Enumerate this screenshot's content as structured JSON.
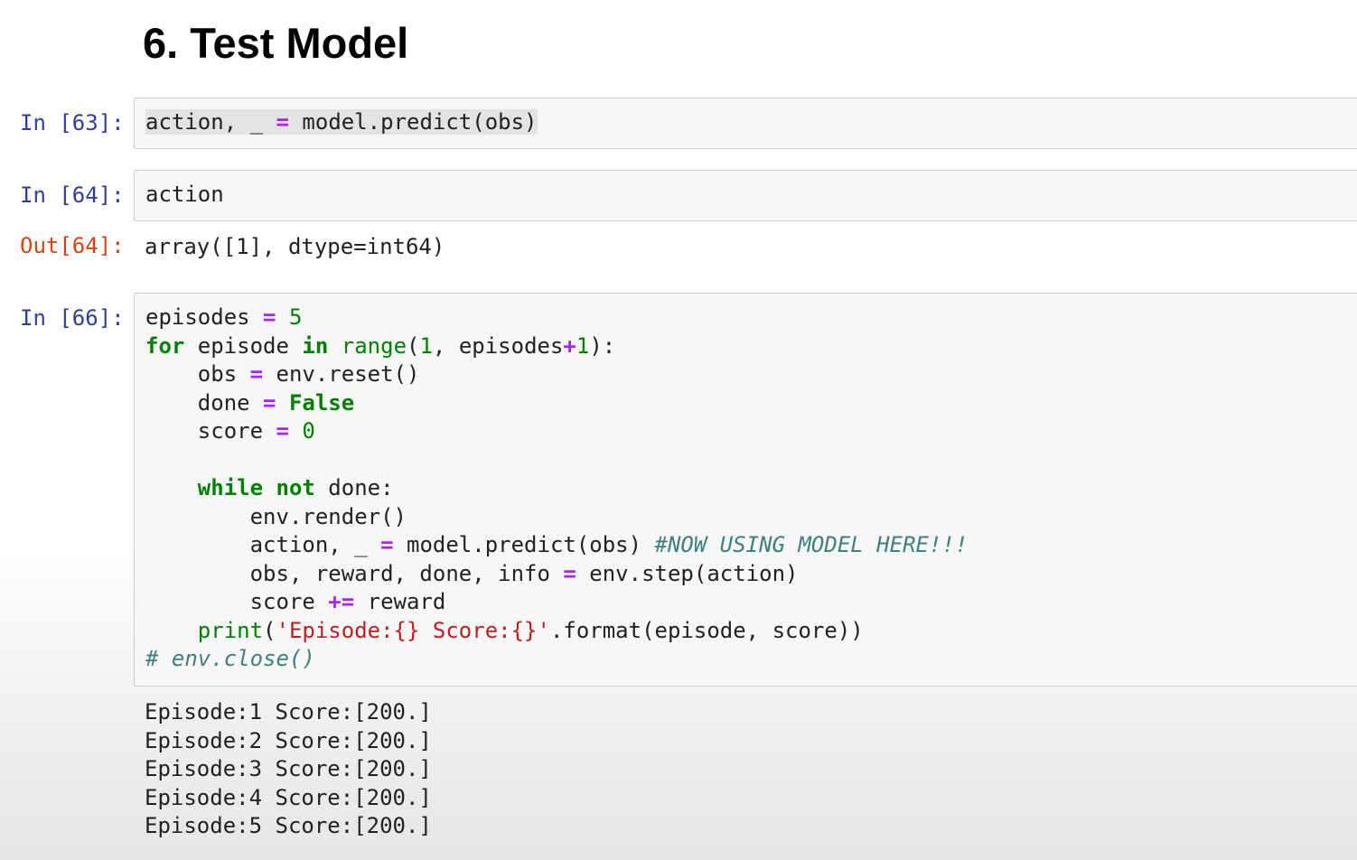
{
  "heading": "6. Test Model",
  "cells": [
    {
      "prompt": "In [63]:",
      "code": {
        "t1": "action,",
        "t2": " ",
        "t3": "_",
        "t4": " ",
        "t5": "=",
        "t6": " model.predict(obs)"
      }
    },
    {
      "prompt": "In [64]:",
      "code": {
        "line1": "action"
      },
      "out_prompt": "Out[64]:",
      "output": "array([1], dtype=int64)"
    },
    {
      "prompt": "In [66]:",
      "code": {
        "l1_a": "episodes ",
        "l1_b": "=",
        "l1_c": " ",
        "l1_d": "5",
        "l2_a": "for",
        "l2_b": " episode ",
        "l2_c": "in",
        "l2_d": " ",
        "l2_e": "range",
        "l2_f": "(",
        "l2_g": "1",
        "l2_h": ", episodes",
        "l2_i": "+",
        "l2_j": "1",
        "l2_k": "):",
        "l3_a": "    obs ",
        "l3_b": "=",
        "l3_c": " env.reset()",
        "l4_a": "    done ",
        "l4_b": "=",
        "l4_c": " ",
        "l4_d": "False",
        "l5_a": "    score ",
        "l5_b": "=",
        "l5_c": " ",
        "l5_d": "0",
        "l7_a": "    ",
        "l7_b": "while",
        "l7_c": " ",
        "l7_d": "not",
        "l7_e": " done:",
        "l8": "        env.render()",
        "l9_a": "        action, _ ",
        "l9_b": "=",
        "l9_c": " model.predict(obs) ",
        "l9_d": "#NOW USING MODEL HERE!!!",
        "l10_a": "        obs, reward, done, info ",
        "l10_b": "=",
        "l10_c": " env.step(action)",
        "l11_a": "        score ",
        "l11_b": "+=",
        "l11_c": " reward",
        "l12_a": "    ",
        "l12_b": "print",
        "l12_c": "(",
        "l12_d": "'Episode:{} Score:{}'",
        "l12_e": ".format(episode, score))",
        "l13": "# env.close()"
      },
      "output_lines": [
        "Episode:1 Score:[200.]",
        "Episode:2 Score:[200.]",
        "Episode:3 Score:[200.]",
        "Episode:4 Score:[200.]",
        "Episode:5 Score:[200.]"
      ]
    }
  ],
  "colors": {
    "in_prompt": "#303f9f",
    "out_prompt": "#d84315",
    "keyword": "#008000",
    "operator": "#aa22ff",
    "string": "#ba2121",
    "comment": "#408080",
    "cell_background": "#f7f7f7",
    "cell_border": "#cfcfcf"
  }
}
